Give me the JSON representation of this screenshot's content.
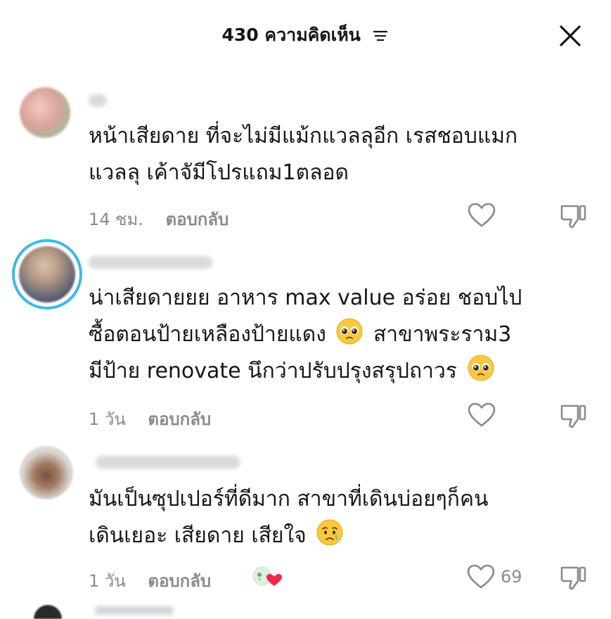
{
  "header": {
    "title": "430 ความคิดเห็น",
    "filter_icon": "filter-lines-icon",
    "close_icon": "close-x-icon"
  },
  "comments": [
    {
      "text_line1": "หน้าเสียดาย ที่จะไม่มีแม้กแวลลุอีก เรสชอบแมก",
      "text_line2": "แวลลุ เค้าจัมีโปรแถม1ตลอด",
      "time": "14 ชม.",
      "reply_label": "ตอบกลับ"
    },
    {
      "text_line1": "น่าเสียดายยย อาหาร max value อร่อย ชอบไป",
      "text_line2_before_emoji": "ซื้อตอนป้ายเหลืองป้ายแดง",
      "text_line2_after_emoji": "สาขาพระราม3",
      "text_line3": "มีป้าย renovate นึกว่าปรับปรุงสรุปถาวร",
      "time": "1 วัน",
      "reply_label": "ตอบกลับ"
    },
    {
      "text_line1": "มันเป็นซุปเปอร์ที่ดีมาก สาขาที่เดินบ่อยๆก็คน",
      "text_line2": "เดินเยอะ เสียดาย เสียใจ",
      "time": "1 วัน",
      "reply_label": "ตอบกลับ",
      "like_count": "69"
    }
  ],
  "colors": {
    "text": "#161616",
    "muted": "#8a8a8f",
    "story_ring": "#3fb8e8",
    "heart_red": "#f0284a"
  }
}
